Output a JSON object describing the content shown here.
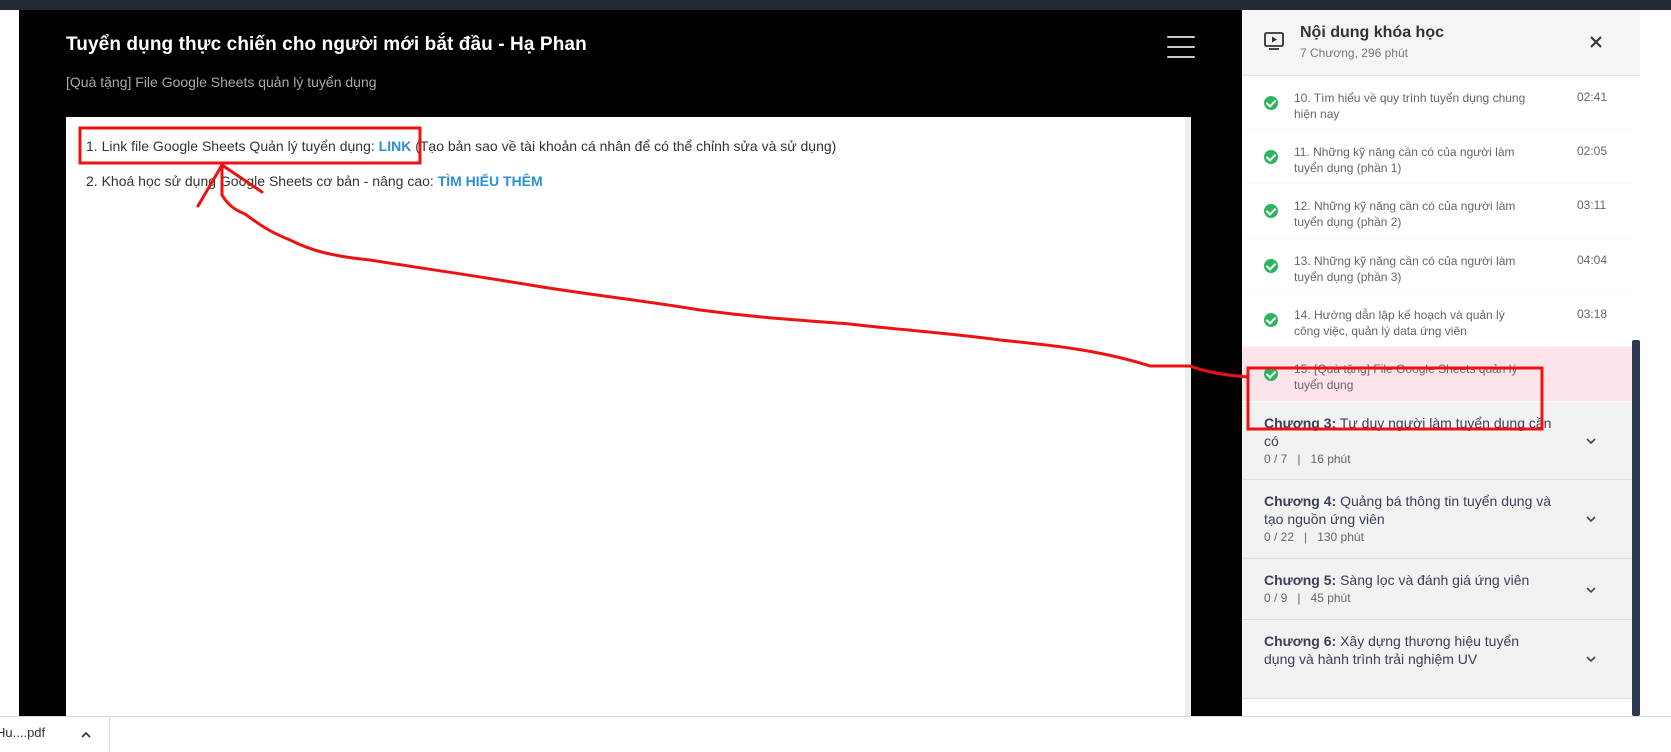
{
  "player": {
    "title": "Tuyển dụng thực chiến cho người mới bắt đầu - Hạ Phan",
    "subtitle": "[Quà tặng] File Google Sheets quản lý tuyển dụng"
  },
  "doc": {
    "line1_text": "1. Link file Google Sheets Quản lý tuyển dụng: ",
    "line1_link": "LINK",
    "line1_suffix": " (Tạo bản sao về tài khoản cá nhân để có thể chỉnh sửa và sử dụng)",
    "line2_text": "2. Khoá học sử dụng Google Sheets cơ bản - nâng cao: ",
    "line2_link": "TÌM HIỂU THÊM"
  },
  "sidebar": {
    "title": "Nội dung khóa học",
    "meta": "7 Chương, 296 phút",
    "lessons": [
      {
        "title": "10. Tìm hiểu về quy trình tuyển dụng chung hiện nay",
        "duration": "02:41"
      },
      {
        "title": "11. Những kỹ năng cần có của người làm tuyển dụng (phần 1)",
        "duration": "02:05"
      },
      {
        "title": "12. Những kỹ năng cần có của người làm tuyển dụng (phần 2)",
        "duration": "03:11"
      },
      {
        "title": "13. Những kỹ năng cần có của người làm tuyển dụng (phần 3)",
        "duration": "04:04"
      },
      {
        "title": "14. Hướng dẫn lập kế hoạch và quản lý công việc, quản lý data ứng viên",
        "duration": "03:18"
      },
      {
        "title": "15. [Quà tặng] File Google Sheets quản lý tuyển dụng",
        "duration": ""
      }
    ],
    "chapters": [
      {
        "label": "Chương 3:",
        "name": "Tư duy người làm tuyển dụng cần có",
        "progress": "0 / 7",
        "duration": "16 phút"
      },
      {
        "label": "Chương 4:",
        "name": "Quảng bá thông tin tuyển dụng và tạo nguồn ứng viên",
        "progress": "0 / 22",
        "duration": "130 phút"
      },
      {
        "label": "Chương 5:",
        "name": "Sàng lọc và đánh giá ứng viên",
        "progress": "0 / 9",
        "duration": "45 phút"
      },
      {
        "label": "Chương 6:",
        "name": "Xây dựng thương hiệu tuyển dụng và hành trình trải nghiệm UV",
        "progress": "",
        "duration": ""
      }
    ],
    "separator": "|"
  },
  "downloads": {
    "file": "Hu....pdf"
  },
  "colors": {
    "accent_link": "#2b8fd6",
    "check_green": "#2db55d",
    "annotation_red": "#ee1111",
    "active_lesson_bg": "#fde3ea"
  }
}
